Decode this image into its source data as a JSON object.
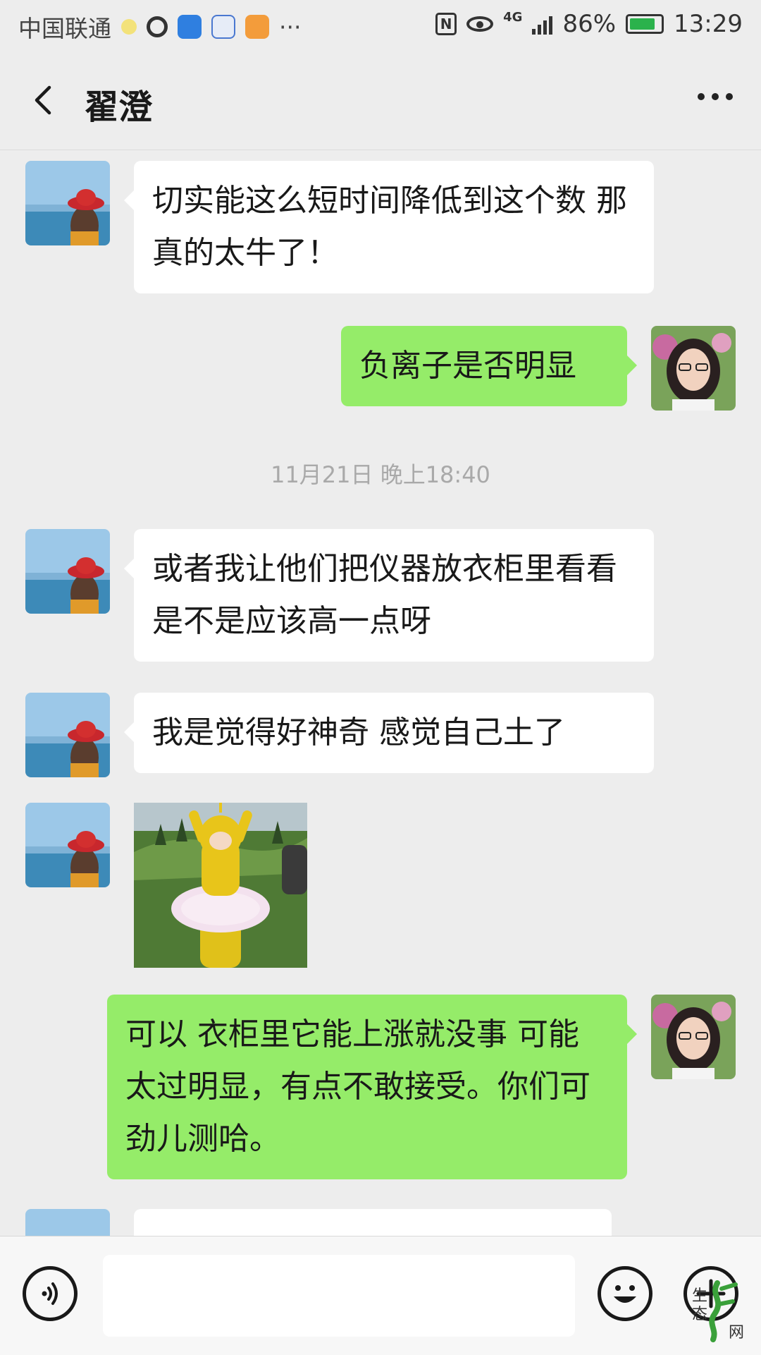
{
  "status_bar": {
    "carrier": "中国联通",
    "more_indicator": "···",
    "network": "4G",
    "battery_percent": "86%",
    "time": "13:29",
    "battery_level": 0.86
  },
  "header": {
    "title": "翟澄"
  },
  "messages": [
    {
      "side": "in",
      "text": "切实能这么短时间降低到这个数 那真的太牛了！"
    },
    {
      "side": "out",
      "text": "负离子是否明显"
    },
    {
      "type": "timestamp",
      "text": "11月21日 晚上18:40"
    },
    {
      "side": "in",
      "text": "或者我让他们把仪器放衣柜里看看 是不是应该高一点呀"
    },
    {
      "side": "in",
      "text": "我是觉得好神奇 感觉自己土了"
    },
    {
      "side": "in",
      "type": "sticker"
    },
    {
      "side": "out",
      "text": "可以 衣柜里它能上涨就没事 可能太过明显，有点不敢接受。你们可劲儿测哈。"
    },
    {
      "side": "in",
      "text": ""
    }
  ],
  "input": {
    "value": "",
    "placeholder": ""
  },
  "watermark": {
    "chars": [
      "生",
      "态",
      "网"
    ]
  },
  "colors": {
    "background": "#ededed",
    "incoming_bubble": "#ffffff",
    "outgoing_bubble": "#95ec69",
    "battery_fill": "#2bb24c"
  },
  "icons": [
    "back-arrow-icon",
    "more-dots-icon",
    "voice-icon",
    "emoji-icon",
    "plus-icon",
    "nfc-icon",
    "eye-icon",
    "signal-icon",
    "battery-icon"
  ]
}
